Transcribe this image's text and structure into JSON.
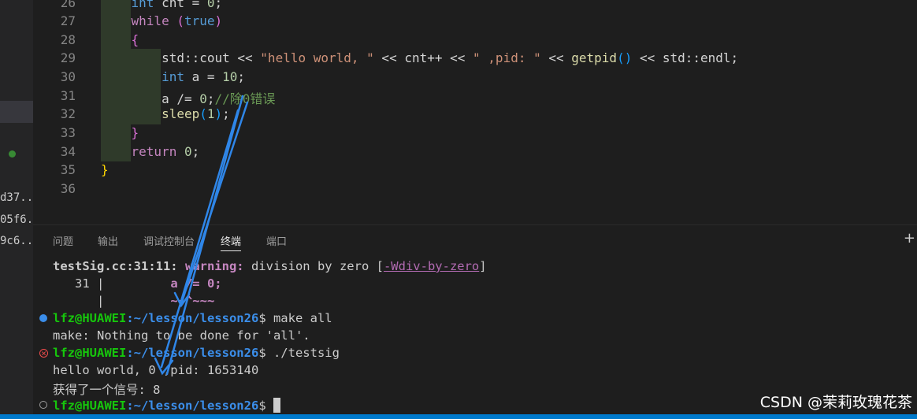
{
  "sidebar": {
    "fragments": [
      "d37...",
      "05f6...",
      "9c6..."
    ]
  },
  "editor": {
    "line_numbers": [
      "26",
      "27",
      "28",
      "29",
      "30",
      "31",
      "32",
      "33",
      "34",
      "35",
      "36"
    ]
  },
  "panel": {
    "tabs": [
      "问题",
      "输出",
      "调试控制台",
      "终端",
      "端口"
    ],
    "active_tab": "终端",
    "plus": "+"
  },
  "terminal": {
    "warning_loc": "testSig.cc:31:11:",
    "warning_word": "warning:",
    "warning_msg": " division by zero [",
    "warning_flag": "-Wdiv-by-zero",
    "warning_end": "]",
    "src_lineno": "   31 |",
    "src_code": "         a /= 0;",
    "marker_bar": "      |",
    "marker": "         ~~^~~~",
    "prompt_user": "lfz@HUAWEI",
    "prompt_path": ":~/lesson/lesson26",
    "cmd1": "$ make all",
    "out1": "make: Nothing to be done for 'all'.",
    "cmd2": "$ ./testsig",
    "out2": "hello world, 0 ,pid: 1653140",
    "out3": "获得了一个信号: 8",
    "cmd3": "$ "
  },
  "watermark": "CSDN @茉莉玫瑰花茶",
  "colors": {
    "accent": "#007acc",
    "arrow": "#2f86e8"
  }
}
